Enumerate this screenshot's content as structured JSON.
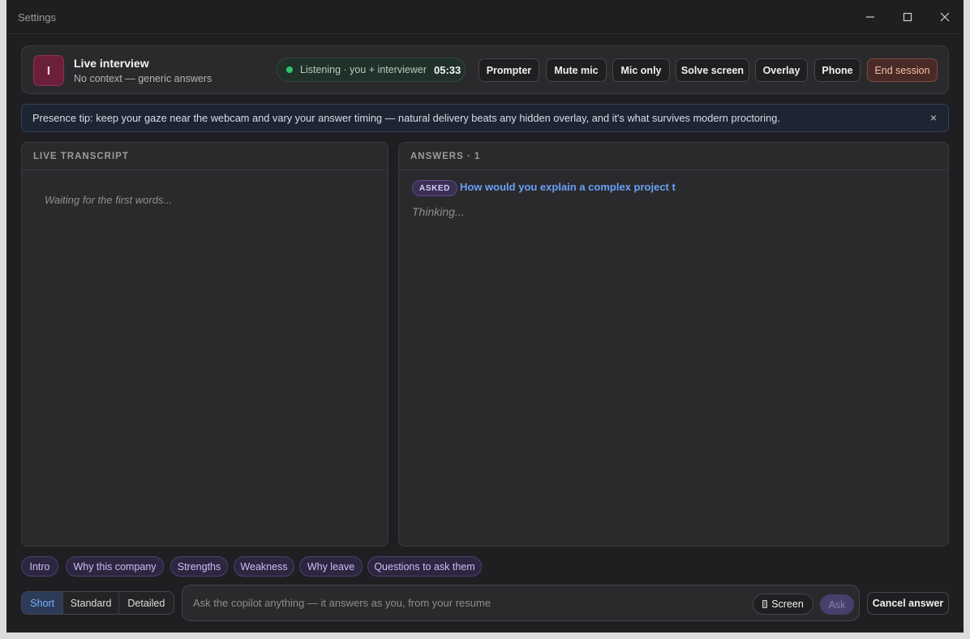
{
  "window": {
    "title": "Settings"
  },
  "header": {
    "avatar_letter": "I",
    "title": "Live interview",
    "subtitle": "No context — generic answers",
    "status": {
      "label": "Listening · you + interviewer",
      "timer": "05:33"
    },
    "buttons": {
      "prompter": "Prompter",
      "mute_mic": "Mute mic",
      "mic_only": "Mic only",
      "solve_screen": "Solve screen",
      "overlay": "Overlay",
      "phone": "Phone",
      "end_session": "End session"
    }
  },
  "tip": {
    "text": "Presence tip: keep your gaze near the webcam and vary your answer timing — natural delivery beats any hidden overlay, and it's what survives modern proctoring.",
    "close": "×"
  },
  "transcript": {
    "heading": "LIVE TRANSCRIPT",
    "empty": "Waiting for the first words..."
  },
  "answers": {
    "heading": "ANSWERS · 1",
    "items": [
      {
        "badge": "ASKED",
        "question": "How would you explain a complex project t",
        "status": "Thinking..."
      }
    ]
  },
  "chips": [
    "Intro",
    "Why this company",
    "Strengths",
    "Weakness",
    "Why leave",
    "Questions to ask them"
  ],
  "length_modes": {
    "options": [
      "Short",
      "Standard",
      "Detailed"
    ],
    "selected": "Short"
  },
  "ask": {
    "placeholder": "Ask the copilot anything — it answers as you, from your resume",
    "screen_label": "Screen",
    "ask_label": "Ask"
  },
  "cancel_label": "Cancel answer",
  "colors": {
    "accent": "#6aa0f5",
    "status_green": "#33c46a",
    "chip_purple": "#cbbdf6",
    "end_session": "#f2c2a6"
  }
}
